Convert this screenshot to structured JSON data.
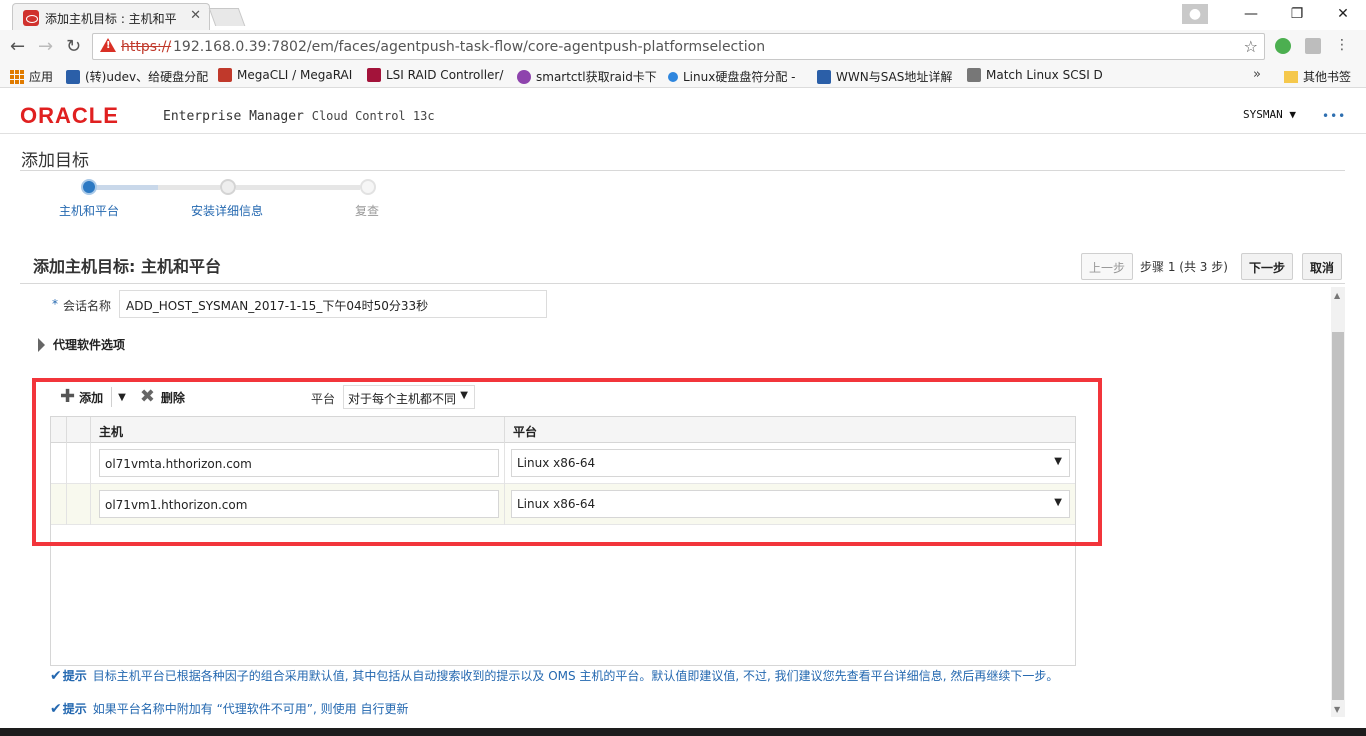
{
  "browser": {
    "tab_title": "添加主机目标 : 主机和平",
    "tab_close": "✕",
    "url_scheme": "https://",
    "url_rest": "192.168.0.39:7802/em/faces/agentpush-task-flow/core-agentpush-platformselection",
    "window_minimize": "—",
    "window_restore": "❐",
    "window_close": "✕"
  },
  "bookmarks": [
    {
      "label": "应用",
      "color": "#e07b00"
    },
    {
      "label": "(转)udev、给硬盘分配",
      "color": "#2b5fa8"
    },
    {
      "label": "MegaCLI / MegaRAI",
      "color": "#c0392b"
    },
    {
      "label": "LSI RAID Controller/",
      "color": "#a3133a"
    },
    {
      "label": "smartctl获取raid卡下",
      "color": "#8e44ad"
    },
    {
      "label": "Linux硬盘盘符分配 -",
      "color": "#2e86de"
    },
    {
      "label": "WWN与SAS地址详解",
      "color": "#2b5fa8"
    },
    {
      "label": "Match Linux SCSI D",
      "color": "#777777"
    }
  ],
  "bookmarks_more": "»",
  "bookmarks_other": "其他书签",
  "header": {
    "brand": "ORACLE",
    "product_main": "Enterprise Manager",
    "product_sub": "Cloud Control 13c",
    "user": "SYSMAN ▼",
    "more": "•••"
  },
  "page": {
    "title": "添加目标",
    "train": [
      {
        "label": "主机和平台",
        "state": "active"
      },
      {
        "label": "安装详细信息",
        "state": "next"
      },
      {
        "label": "复查",
        "state": "disabled"
      }
    ],
    "section_title": "添加主机目标: 主机和平台",
    "prev_button": "上一步",
    "step_text": "步骤 1 (共 3 步)",
    "next_button": "下一步",
    "cancel_button": "取消",
    "session_label": "会话名称",
    "session_value": "ADD_HOST_SYSMAN_2017-1-15_下午04时50分33秒",
    "agent_options": "代理软件选项"
  },
  "table": {
    "add_label": "添加",
    "delete_label": "删除",
    "platform_label": "平台",
    "platform_mode": "对于每个主机都不同",
    "columns": [
      "主机",
      "平台"
    ],
    "rows": [
      {
        "host": "ol71vmta.hthorizon.com",
        "platform": "Linux x86-64"
      },
      {
        "host": "ol71vm1.hthorizon.com",
        "platform": "Linux x86-64"
      }
    ]
  },
  "tips": [
    {
      "label": "提示",
      "text": "目标主机平台已根据各种因子的组合采用默认值, 其中包括从自动搜索收到的提示以及 OMS 主机的平台。默认值即建议值, 不过, 我们建议您先查看平台详细信息, 然后再继续下一步。"
    },
    {
      "label": "提示",
      "text": "如果平台名称中附加有 “代理软件不可用”, 则使用 自行更新"
    }
  ],
  "colors": {
    "highlight_box": "#f2353b",
    "link": "#2468b0",
    "brand_red": "#e02020"
  }
}
